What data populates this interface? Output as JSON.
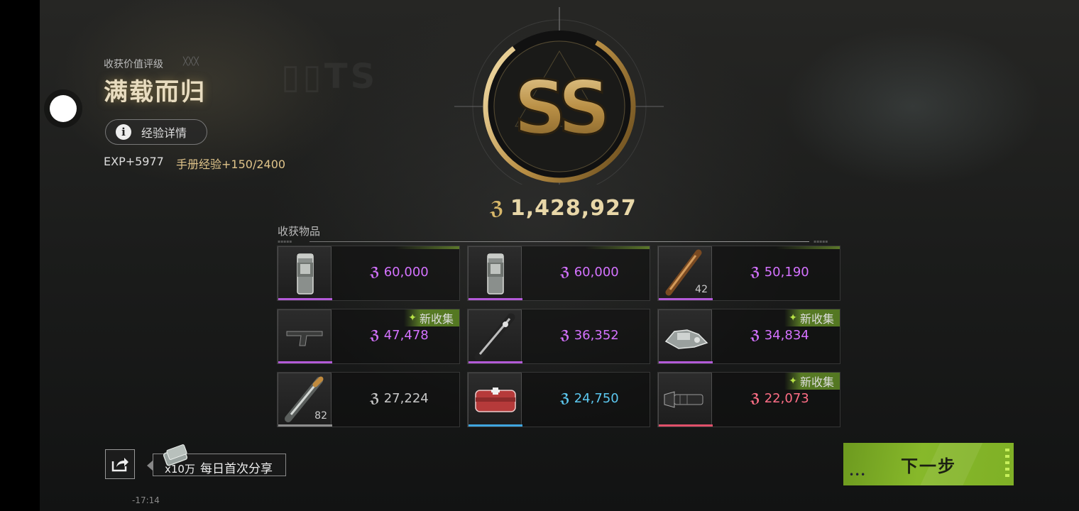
{
  "rating": {
    "label": "收获价值评级",
    "title": "满载而归",
    "grade": "SS",
    "total_value": "1,428,927"
  },
  "exp": {
    "detail_button_label": "经验详情",
    "exp_gain": "EXP+5977",
    "manual_exp": "手册经验+150/2400"
  },
  "loot": {
    "label": "收获物品",
    "items": [
      {
        "value": "60,000",
        "qty": "",
        "new": "",
        "rarity_color": "#b35ad8",
        "value_color": "#d472ff",
        "icon": "grenade-icon"
      },
      {
        "value": "60,000",
        "qty": "",
        "new": "",
        "rarity_color": "#b35ad8",
        "value_color": "#d472ff",
        "icon": "grenade-icon"
      },
      {
        "value": "50,190",
        "qty": "42",
        "new": "",
        "rarity_color": "#b35ad8",
        "value_color": "#d472ff",
        "icon": "bullet-icon"
      },
      {
        "value": "47,478",
        "qty": "",
        "new": "新收集",
        "rarity_color": "#b35ad8",
        "value_color": "#d472ff",
        "icon": "stock-icon"
      },
      {
        "value": "36,352",
        "qty": "",
        "new": "",
        "rarity_color": "#b35ad8",
        "value_color": "#d472ff",
        "icon": "injector-icon"
      },
      {
        "value": "34,834",
        "qty": "",
        "new": "新收集",
        "rarity_color": "#b35ad8",
        "value_color": "#d472ff",
        "icon": "scrap-parts-icon"
      },
      {
        "value": "27,224",
        "qty": "82",
        "new": "",
        "rarity_color": "#8c8c8c",
        "value_color": "#c8c8c8",
        "icon": "rifle-round-icon"
      },
      {
        "value": "24,750",
        "qty": "",
        "new": "",
        "rarity_color": "#3fa6e0",
        "value_color": "#5cc8f0",
        "icon": "medkit-icon"
      },
      {
        "value": "22,073",
        "qty": "",
        "new": "新收集",
        "rarity_color": "#e0506a",
        "value_color": "#ff6e86",
        "icon": "flashlight-icon"
      }
    ]
  },
  "share": {
    "multiplier": "x10万",
    "text": "每日首次分享"
  },
  "time": "-17:14",
  "next_button_label": "下一步",
  "colors": {
    "gold": "#c9a35a",
    "accent_green": "#87b82a"
  }
}
